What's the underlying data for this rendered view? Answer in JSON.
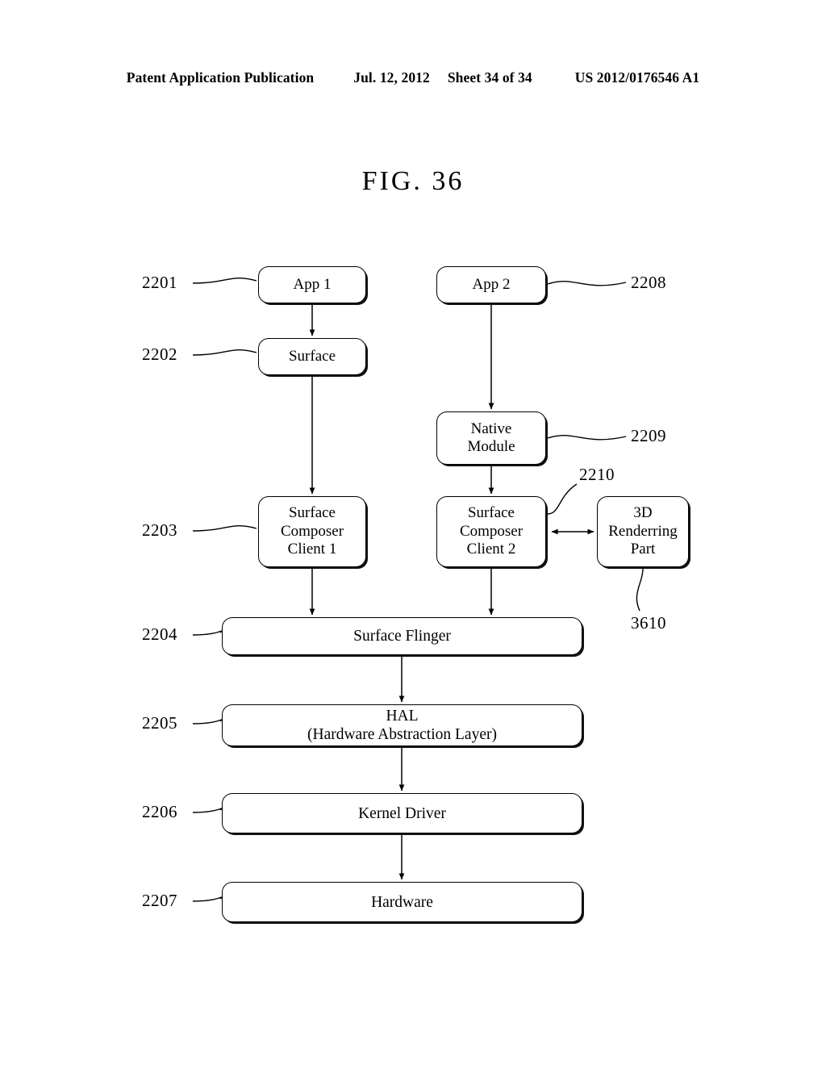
{
  "header": {
    "publication": "Patent Application Publication",
    "date": "Jul. 12, 2012",
    "sheet": "Sheet 34 of 34",
    "patent_number": "US 2012/0176546 A1"
  },
  "figure": {
    "title": "FIG. 36"
  },
  "diagram": {
    "type": "block-diagram",
    "nodes": [
      {
        "id": "app1",
        "label": "App 1"
      },
      {
        "id": "surface",
        "label": "Surface"
      },
      {
        "id": "scc1",
        "label": "Surface\nComposer\nClient 1"
      },
      {
        "id": "app2",
        "label": "App 2"
      },
      {
        "id": "native",
        "label": "Native\nModule"
      },
      {
        "id": "scc2",
        "label": "Surface\nComposer\nClient 2"
      },
      {
        "id": "render3d",
        "label": "3D\nRenderring\nPart"
      },
      {
        "id": "flinger",
        "label": "Surface Flinger"
      },
      {
        "id": "hal",
        "label": "HAL\n(Hardware Abstraction Layer)"
      },
      {
        "id": "kernel",
        "label": "Kernel Driver"
      },
      {
        "id": "hardware",
        "label": "Hardware"
      }
    ],
    "node_labels": {
      "app1": "App 1",
      "surface": "Surface",
      "scc1_line1": "Surface",
      "scc1_line2": "Composer",
      "scc1_line3": "Client 1",
      "app2": "App 2",
      "native_line1": "Native",
      "native_line2": "Module",
      "scc2_line1": "Surface",
      "scc2_line2": "Composer",
      "scc2_line3": "Client 2",
      "render3d_line1": "3D",
      "render3d_line2": "Renderring",
      "render3d_line3": "Part",
      "flinger": "Surface Flinger",
      "hal_line1": "HAL",
      "hal_line2": "(Hardware Abstraction Layer)",
      "kernel": "Kernel Driver",
      "hardware": "Hardware"
    },
    "reference_numerals": {
      "app1": "2201",
      "surface": "2202",
      "scc1": "2203",
      "flinger": "2204",
      "hal": "2205",
      "kernel": "2206",
      "hardware": "2207",
      "app2": "2208",
      "native": "2209",
      "scc2": "2210",
      "render3d": "3610"
    },
    "edges": [
      {
        "from": "app1",
        "to": "surface",
        "style": "arrow"
      },
      {
        "from": "surface",
        "to": "scc1",
        "style": "arrow"
      },
      {
        "from": "scc1",
        "to": "flinger",
        "style": "arrow"
      },
      {
        "from": "app2",
        "to": "native",
        "style": "arrow"
      },
      {
        "from": "native",
        "to": "scc2",
        "style": "arrow"
      },
      {
        "from": "scc2",
        "to": "flinger",
        "style": "arrow"
      },
      {
        "from": "scc2",
        "to": "render3d",
        "style": "double-arrow"
      },
      {
        "from": "flinger",
        "to": "hal",
        "style": "arrow"
      },
      {
        "from": "hal",
        "to": "kernel",
        "style": "arrow"
      },
      {
        "from": "kernel",
        "to": "hardware",
        "style": "arrow"
      }
    ]
  }
}
